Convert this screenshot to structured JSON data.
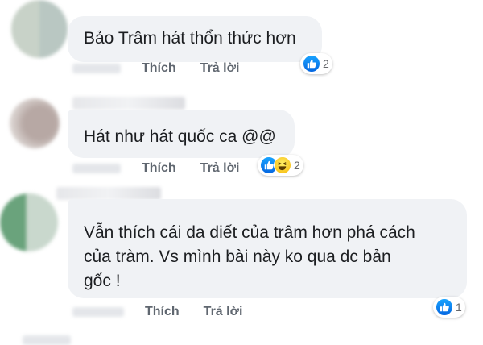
{
  "comments": [
    {
      "text_lines": [
        "Bảo Trâm hát thổn thức hơn"
      ],
      "actions": {
        "like_label": "Thích",
        "reply_label": "Trả lời"
      },
      "reactions": {
        "types": [
          "like-icon"
        ],
        "count": "2"
      }
    },
    {
      "text_lines": [
        "Hát như hát quốc ca @@"
      ],
      "actions": {
        "like_label": "Thích",
        "reply_label": "Trả lời"
      },
      "reactions": {
        "types": [
          "like-icon",
          "haha-icon"
        ],
        "count": "2"
      }
    },
    {
      "text_lines": [
        "Vẫn thích cái da diết của trâm hơn phá cách",
        "của tràm. Vs mình bài này ko qua dc bản",
        "gốc !"
      ],
      "actions": {
        "like_label": "Thích",
        "reply_label": "Trả lời"
      },
      "reactions": {
        "types": [
          "like-icon"
        ],
        "count": "1"
      }
    }
  ],
  "colors": {
    "bubble_bg": "#f0f2f5",
    "action_text": "#606770",
    "like_blue": "#0a7cff"
  }
}
